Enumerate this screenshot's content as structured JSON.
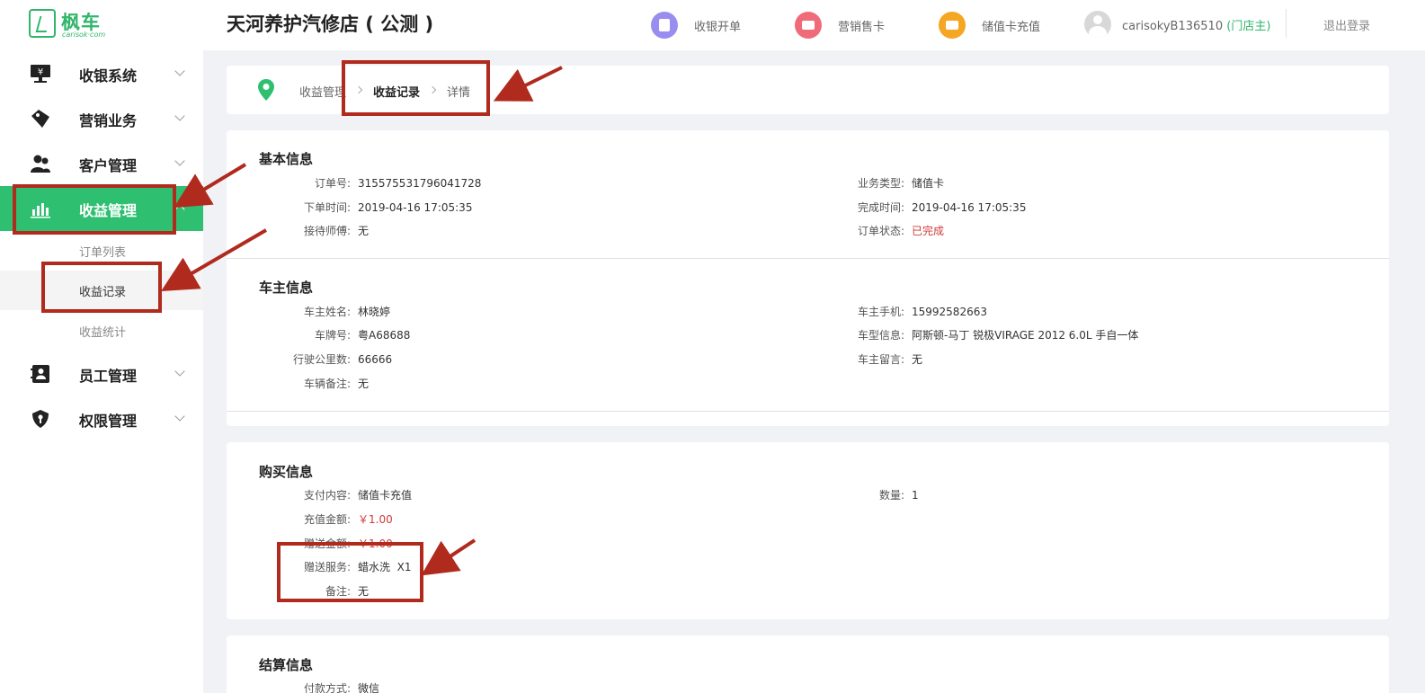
{
  "logo": {
    "name": "枫车",
    "sub": "carisok·com"
  },
  "sidebar": {
    "items": [
      {
        "label": "收银系统",
        "icon": "cashier-icon"
      },
      {
        "label": "营销业务",
        "icon": "tag-icon"
      },
      {
        "label": "客户管理",
        "icon": "users-icon"
      },
      {
        "label": "收益管理",
        "icon": "bar-chart-icon",
        "active": true
      },
      {
        "label": "员工管理",
        "icon": "contacts-icon"
      },
      {
        "label": "权限管理",
        "icon": "shield-icon"
      }
    ],
    "subitems": [
      "订单列表",
      "收益记录",
      "收益统计"
    ]
  },
  "header": {
    "shop_title": "天河养护汽修店 ( 公测 )",
    "actions": [
      {
        "label": "收银开单",
        "color": "#9a8df0"
      },
      {
        "label": "营销售卡",
        "color": "#f06b7a"
      },
      {
        "label": "储值卡充值",
        "color": "#f5a623"
      }
    ],
    "username": "carisokyB136510",
    "role": "(门店主)",
    "logout": "退出登录"
  },
  "breadcrumb": [
    "收益管理",
    "收益记录",
    "详情"
  ],
  "basic": {
    "title": "基本信息",
    "order_no_k": "订单号:",
    "order_no_v": "315575531796041728",
    "biz_type_k": "业务类型:",
    "biz_type_v": "储值卡",
    "order_time_k": "下单时间:",
    "order_time_v": "2019-04-16 17:05:35",
    "done_time_k": "完成时间:",
    "done_time_v": "2019-04-16 17:05:35",
    "tech_k": "接待师傅:",
    "tech_v": "无",
    "status_k": "订单状态:",
    "status_v": "已完成"
  },
  "owner": {
    "title": "车主信息",
    "name_k": "车主姓名:",
    "name_v": "林晓婷",
    "phone_k": "车主手机:",
    "phone_v": "15992582663",
    "plate_k": "车牌号:",
    "plate_v": "粤A68688",
    "model_k": "车型信息:",
    "model_v": "阿斯顿-马丁 锐极VIRAGE 2012 6.0L 手自一体",
    "mileage_k": "行驶公里数:",
    "mileage_v": "66666",
    "msg_k": "车主留言:",
    "msg_v": "无",
    "note_k": "车辆备注:",
    "note_v": "无"
  },
  "purchase": {
    "title": "购买信息",
    "content_k": "支付内容:",
    "content_v": "储值卡充值",
    "qty_k": "数量:",
    "qty_v": "1",
    "recharge_k": "充值金额:",
    "recharge_v": "￥1.00",
    "gift_amt_k": "赠送金额:",
    "gift_amt_v": "￥1.00",
    "gift_svc_k": "赠送服务:",
    "gift_svc_v": "蜡水洗  X1",
    "remark_k": "备注:",
    "remark_v": "无"
  },
  "settle": {
    "title": "结算信息",
    "pay_k": "付款方式:",
    "pay_v": "微信"
  }
}
